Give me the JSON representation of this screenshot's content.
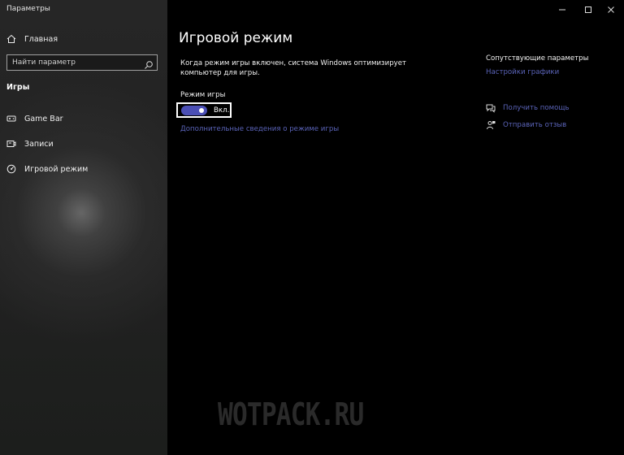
{
  "window": {
    "title": "Параметры"
  },
  "sidebar": {
    "home_label": "Главная",
    "search_placeholder": "Найти параметр",
    "section_title": "Игры",
    "items": [
      {
        "label": "Game Bar",
        "icon": "game-bar-icon"
      },
      {
        "label": "Записи",
        "icon": "captures-icon"
      },
      {
        "label": "Игровой режим",
        "icon": "game-mode-icon"
      }
    ]
  },
  "main": {
    "title": "Игровой режим",
    "description": "Когда режим игры включен, система Windows оптимизирует компьютер для игры.",
    "toggle_label": "Режим игры",
    "toggle_state": "Вкл.",
    "toggle_on": true,
    "more_info_link": "Дополнительные сведения о режиме игры"
  },
  "related": {
    "title": "Сопутствующие параметры",
    "graphics_link": "Настройки графики",
    "help_link": "Получить помощь",
    "feedback_link": "Отправить отзыв"
  },
  "watermark": "WOTPACK.RU",
  "colors": {
    "accent": "#4b4fb5",
    "link": "#5a63b8",
    "background": "#000000",
    "sidebar": "#232323"
  }
}
